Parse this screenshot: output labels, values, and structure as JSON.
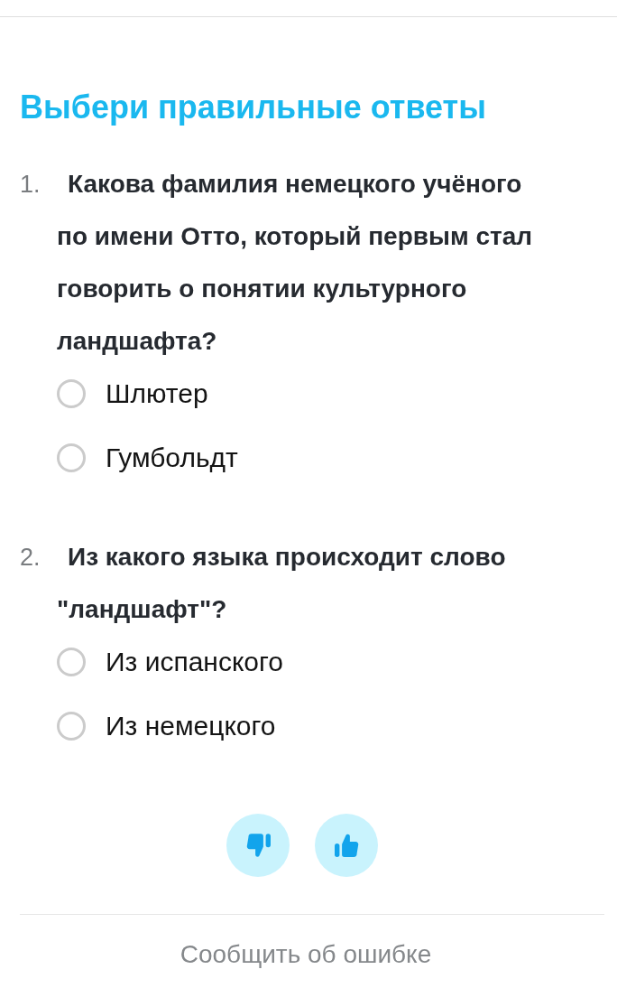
{
  "title": "Выбери правильные ответы",
  "questions": [
    {
      "number": "1.",
      "text": "Какова фамилия немецкого учёного по имени Отто, который первым стал говорить о понятии культурного ландшафта?",
      "options": [
        {
          "label": "Шлютер",
          "selected": false
        },
        {
          "label": "Гумбольдт",
          "selected": false
        }
      ]
    },
    {
      "number": "2.",
      "text": "Из какого языка происходит слово \"ландшафт\"?",
      "options": [
        {
          "label": "Из испанского",
          "selected": false
        },
        {
          "label": "Из немецкого",
          "selected": false
        }
      ]
    }
  ],
  "feedback": [
    {
      "kind": "dislike"
    },
    {
      "kind": "like"
    }
  ],
  "report_link": "Сообщить об ошибке"
}
